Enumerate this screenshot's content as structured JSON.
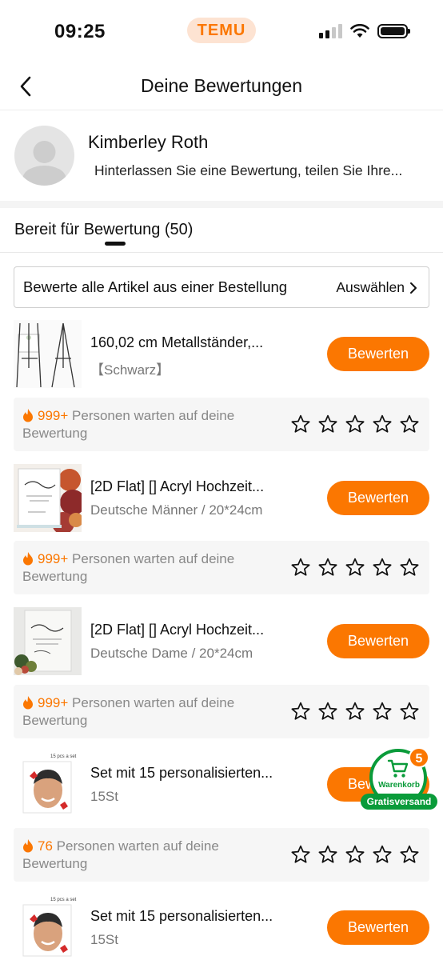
{
  "status_bar": {
    "time": "09:25",
    "app_pill": "TEMU"
  },
  "header": {
    "title": "Deine Bewertungen"
  },
  "profile": {
    "name": "Kimberley Roth",
    "subtitle": "Hinterlassen Sie eine Bewertung, teilen Sie Ihre..."
  },
  "tab": {
    "label": "Bereit für Bewertung (50)"
  },
  "order_bar": {
    "text": "Bewerte alle Artikel aus einer Bestellung",
    "action": "Auswählen"
  },
  "products": [
    {
      "title": "160,02 cm Metallständer,...",
      "variant": "【Schwarz】",
      "button": "Bewerten",
      "waiting_count": "999+",
      "waiting_text": " Personen warten auf deine Bewertung",
      "thumb_icon": "metal-easel-thumbnail"
    },
    {
      "title": "[2D Flat] [] Acryl Hochzeit...",
      "variant": "Deutsche Männer / 20*24cm",
      "button": "Bewerten",
      "waiting_count": "999+",
      "waiting_text": " Personen warten auf deine Bewertung",
      "thumb_icon": "acrylic-sign-roses-thumbnail"
    },
    {
      "title": "[2D Flat] [] Acryl Hochzeit...",
      "variant": "Deutsche Dame / 20*24cm",
      "button": "Bewerten",
      "waiting_count": "999+",
      "waiting_text": " Personen warten auf deine Bewertung",
      "thumb_icon": "acrylic-sign-flowers-thumbnail"
    },
    {
      "title": "Set mit 15 personalisierten...",
      "variant": "15St",
      "button": "Bewerten",
      "waiting_count": "76",
      "waiting_text": " Personen warten auf deine Bewertung",
      "thumb_icon": "face-cutout-thumbnail",
      "thumb_caption": "15 pcs a set"
    },
    {
      "title": "Set mit 15 personalisierten...",
      "variant": "15St",
      "button": "Bewerten",
      "thumb_icon": "face-cutout-thumbnail",
      "thumb_caption": "15 pcs a set"
    }
  ],
  "cart": {
    "count": "5",
    "label": "Warenkorb",
    "shipping": "Gratisversand"
  },
  "colors": {
    "accent": "#fb7701",
    "cart_green": "#0a9b3a",
    "muted": "#888888"
  }
}
